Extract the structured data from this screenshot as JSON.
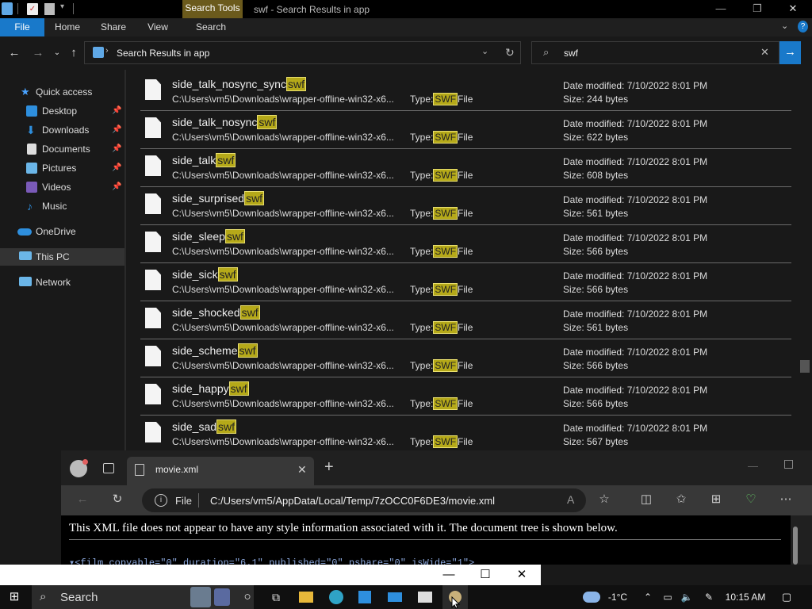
{
  "titlebar": {
    "context_tab": "Search Tools",
    "title": "swf - Search Results in app"
  },
  "ribbon": {
    "tabs": [
      "File",
      "Home",
      "Share",
      "View",
      "Search"
    ]
  },
  "address": {
    "location": "Search Results in app"
  },
  "search": {
    "query": "swf"
  },
  "nav": {
    "items": [
      "Quick access",
      "Desktop",
      "Downloads",
      "Documents",
      "Pictures",
      "Videos",
      "Music",
      "OneDrive",
      "This PC",
      "Network"
    ]
  },
  "files": {
    "path": "C:\\Users\\vm5\\Downloads\\wrapper-offline-win32-x6...",
    "type_prefix": "Type:",
    "type_suffix": "File",
    "highlight": "swf",
    "highlight_upper": "SWF",
    "date_label": "Date modified:",
    "size_label": "Size:",
    "rows": [
      {
        "name": "side_talk_nosync_sync",
        "date": "7/10/2022 8:01 PM",
        "size": "244 bytes"
      },
      {
        "name": "side_talk_nosync",
        "date": "7/10/2022 8:01 PM",
        "size": "622 bytes"
      },
      {
        "name": "side_talk",
        "date": "7/10/2022 8:01 PM",
        "size": "608 bytes"
      },
      {
        "name": "side_surprised",
        "date": "7/10/2022 8:01 PM",
        "size": "561 bytes"
      },
      {
        "name": "side_sleep",
        "date": "7/10/2022 8:01 PM",
        "size": "566 bytes"
      },
      {
        "name": "side_sick",
        "date": "7/10/2022 8:01 PM",
        "size": "566 bytes"
      },
      {
        "name": "side_shocked",
        "date": "7/10/2022 8:01 PM",
        "size": "561 bytes"
      },
      {
        "name": "side_scheme",
        "date": "7/10/2022 8:01 PM",
        "size": "566 bytes"
      },
      {
        "name": "side_happy",
        "date": "7/10/2022 8:01 PM",
        "size": "566 bytes"
      },
      {
        "name": "side_sad",
        "date": "7/10/2022 8:01 PM",
        "size": "567 bytes"
      }
    ]
  },
  "browser": {
    "tab_title": "movie.xml",
    "url_scheme_label": "File",
    "url": "C:/Users/vm5/AppData/Local/Temp/7zOCC0F6DE3/movie.xml",
    "message": "This XML file does not appear to have any style information associated with it. The document tree is shown below.",
    "xml_line": "▾<film copyable=\"0\" duration=\"6.1\" published=\"0\" pshare=\"0\" isWide=\"1\">"
  },
  "taskbar": {
    "search_label": "Search",
    "temperature": "-1°C",
    "time": "10:15 AM"
  },
  "colors": {
    "accent": "#1979ca",
    "highlight": "#b5a919",
    "context_tab": "#6b5a1c"
  }
}
